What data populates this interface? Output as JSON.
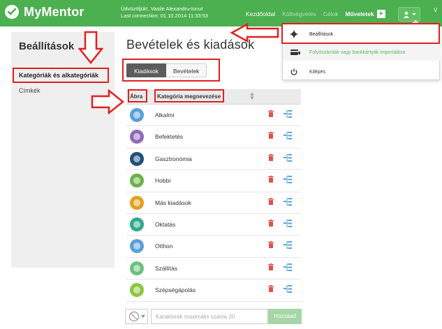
{
  "header": {
    "brand": "MyMentor",
    "greeting_line1": "Üdvözöljük!, Vasile Alexandru-Ionut",
    "greeting_line2": "Last connection: 01.10.2014 11:33:53",
    "nav": {
      "home": "Kezdőoldal",
      "expenses": "Költségvetés",
      "goals": "Célok",
      "actions": "Műveletek",
      "actions_plus": "+"
    },
    "edge_text": "V",
    "colors": {
      "brand_green": "#4caf50",
      "dim_link": "#b9dfba"
    }
  },
  "user_menu": {
    "items": [
      {
        "label": "Beállítások",
        "icon": "gear-icon"
      },
      {
        "label": "Folyószámlák vagy bankkártyák importálása",
        "icon": "card-import-icon"
      },
      {
        "label": "Kilépés",
        "icon": "power-icon"
      }
    ]
  },
  "sidebar": {
    "title": "Beállítások",
    "items": [
      {
        "label": "Kategóriák és alkategóriák",
        "active": true
      },
      {
        "label": "Címkék",
        "active": false
      }
    ]
  },
  "main": {
    "title": "Bevételek és kiadások",
    "tabs": [
      {
        "label": "Kiadások",
        "active": true
      },
      {
        "label": "Bevételek",
        "active": false
      }
    ],
    "table": {
      "col_icon": "Ábra",
      "col_name": "Kategória megnevezése",
      "rows": [
        {
          "name": "Alkalmi",
          "icon": "calendar-icon",
          "color": "#5aa0d8"
        },
        {
          "name": "Befektetés",
          "icon": "investment-icon",
          "color": "#8e6bb8"
        },
        {
          "name": "Gasztronómia",
          "icon": "cutlery-icon",
          "color": "#1f4f7a"
        },
        {
          "name": "Hobbi",
          "icon": "hobby-icon",
          "color": "#6ab04c"
        },
        {
          "name": "Más kiadások",
          "icon": "nuclear-icon",
          "color": "#e0a020"
        },
        {
          "name": "Oktatás",
          "icon": "graduation-cap-icon",
          "color": "#2eaa8a"
        },
        {
          "name": "Otthon",
          "icon": "house-icon",
          "color": "#5aa0d8"
        },
        {
          "name": "Szállítás",
          "icon": "car-icon",
          "color": "#6cc07a"
        },
        {
          "name": "Szépségápolás",
          "icon": "beauty-icon",
          "color": "#8cc63f"
        }
      ]
    },
    "add_form": {
      "placeholder": "Karakterek maximális száma 20",
      "button": "Hozzáad"
    }
  }
}
